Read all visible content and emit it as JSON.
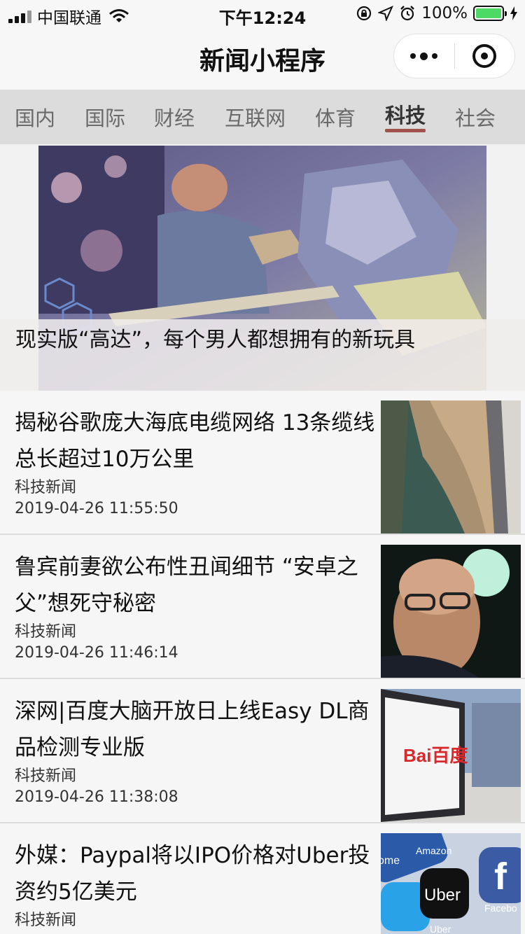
{
  "status_bar": {
    "carrier": "中国联通",
    "time": "下午12:24",
    "battery_text": "100%",
    "battery_level": 1.0,
    "battery_color": "#4cd964"
  },
  "nav": {
    "title": "新闻小程序",
    "more_icon": "more-dots-icon",
    "close_icon": "target-ring-icon"
  },
  "tabs": [
    {
      "label": "国内"
    },
    {
      "label": "国际"
    },
    {
      "label": "财经"
    },
    {
      "label": "互联网"
    },
    {
      "label": "体育"
    },
    {
      "label": "科技",
      "active": true
    },
    {
      "label": "社会"
    }
  ],
  "accent_color": "#a0524c",
  "hero": {
    "caption": "现实版“高达”，每个男人都想拥有的新玩具"
  },
  "news": [
    {
      "title": "揭秘谷歌庞大海底电缆网络 13条缆线总长超过10万公里",
      "category": "科技新闻",
      "time": "2019-04-26 11:55:50"
    },
    {
      "title": "鲁宾前妻欲公布性丑闻细节 “安卓之父”想死守秘密",
      "category": "科技新闻",
      "time": "2019-04-26 11:46:14"
    },
    {
      "title": "深网|百度大脑开放日上线Easy DL商品检测专业版",
      "category": "科技新闻",
      "time": "2019-04-26 11:38:08",
      "thumb_logo": "Bai百度"
    },
    {
      "title": "外媒：Paypal将以IPO价格对Uber投资约5亿美元",
      "category": "科技新闻",
      "time": "",
      "thumb_labels": [
        "Amazon",
        "ome",
        "Uber",
        "Facebo",
        "Uber"
      ]
    }
  ]
}
